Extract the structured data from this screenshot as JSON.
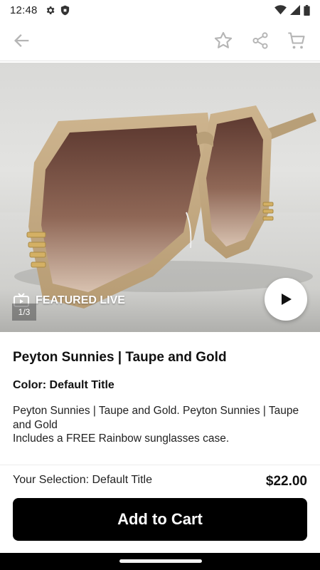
{
  "status_bar": {
    "time": "12:48",
    "left_icons": [
      "gear-icon",
      "shield-icon"
    ],
    "right_icons": [
      "wifi-icon",
      "signal-icon",
      "battery-icon"
    ]
  },
  "app_bar": {
    "icons": [
      "back-arrow-icon",
      "star-icon",
      "share-icon",
      "cart-icon"
    ]
  },
  "media": {
    "featured_label": "FEATURED LIVE",
    "counter": "1/3",
    "icons": [
      "tv-icon",
      "play-icon"
    ]
  },
  "product": {
    "title": "Peyton Sunnies | Taupe and Gold",
    "color_line": "Color: Default Title",
    "description_line1": "Peyton Sunnies | Taupe and Gold. Peyton Sunnies | Taupe and Gold",
    "description_line2": "Includes a FREE Rainbow sunglasses case."
  },
  "purchase": {
    "selection": "Your Selection: Default Title",
    "price": "$22.00",
    "add_to_cart_label": "Add to Cart"
  },
  "colors": {
    "primary_button": "#000000",
    "frame_taupe": "#c4ab86",
    "lens_brown": "#7a5143",
    "gold": "#d4b064"
  }
}
